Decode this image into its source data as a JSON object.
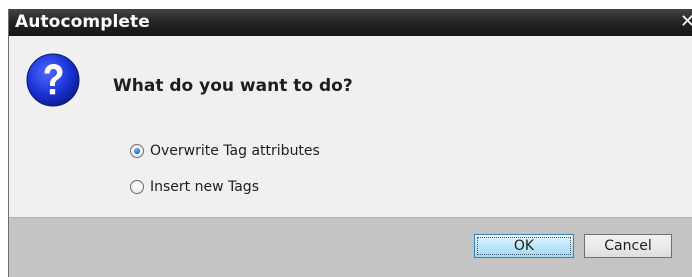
{
  "dialog": {
    "title": "Autocomplete",
    "close_glyph": "✕"
  },
  "content": {
    "icon": "question-icon",
    "question": "What do you want to do?",
    "options": [
      {
        "label": "Overwrite Tag attributes",
        "checked": true
      },
      {
        "label": "Insert new Tags",
        "checked": false
      }
    ]
  },
  "buttons": {
    "ok": "OK",
    "cancel": "Cancel"
  },
  "colors": {
    "titlebar": "#262626",
    "body": "#f0f0f0",
    "footer": "#c4c4c4",
    "icon_blue": "#1b33d6",
    "ok_button": "#bee6fd"
  }
}
